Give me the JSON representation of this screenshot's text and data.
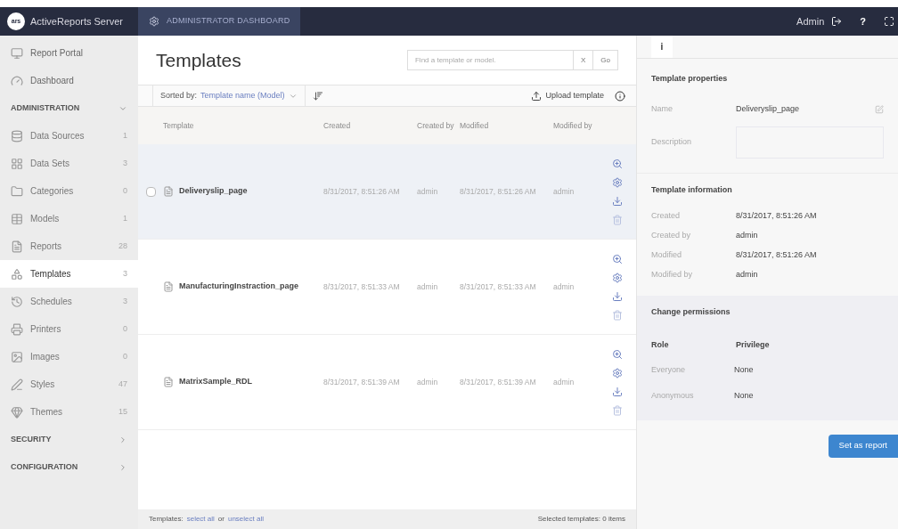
{
  "topbar": {
    "brand": "ActiveReports Server",
    "logo": "ars",
    "tab": "ADMINISTRATOR DASHBOARD",
    "user": "Admin",
    "help": "?"
  },
  "sidebar": {
    "links": [
      {
        "label": "Report Portal"
      },
      {
        "label": "Dashboard"
      }
    ],
    "sections": [
      {
        "title": "ADMINISTRATION",
        "expanded": true,
        "items": [
          {
            "label": "Data Sources",
            "count": "1",
            "selected": false
          },
          {
            "label": "Data Sets",
            "count": "3",
            "selected": false
          },
          {
            "label": "Categories",
            "count": "0",
            "selected": false
          },
          {
            "label": "Models",
            "count": "1",
            "selected": false
          },
          {
            "label": "Reports",
            "count": "28",
            "selected": false
          },
          {
            "label": "Templates",
            "count": "3",
            "selected": true
          },
          {
            "label": "Schedules",
            "count": "3",
            "selected": false
          },
          {
            "label": "Printers",
            "count": "0",
            "selected": false
          },
          {
            "label": "Images",
            "count": "0",
            "selected": false
          },
          {
            "label": "Styles",
            "count": "47",
            "selected": false
          },
          {
            "label": "Themes",
            "count": "15",
            "selected": false
          }
        ]
      },
      {
        "title": "SECURITY",
        "expanded": false
      },
      {
        "title": "CONFIGURATION",
        "expanded": false
      }
    ]
  },
  "main": {
    "title": "Templates",
    "search": {
      "placeholder": "Find a template or model.",
      "clear": "X",
      "go": "Go"
    },
    "sort": {
      "label": "Sorted by:",
      "value": "Template name (Model)"
    },
    "upload": "Upload template",
    "columns": [
      "Template",
      "Created",
      "Created by",
      "Modified",
      "Modified by"
    ],
    "rows": [
      {
        "name": "Deliveryslip_page",
        "created": "8/31/2017, 8:51:26 AM",
        "created_by": "admin",
        "modified": "8/31/2017, 8:51:26 AM",
        "modified_by": "admin",
        "selected": true
      },
      {
        "name": "ManufacturingInstraction_page",
        "created": "8/31/2017, 8:51:33 AM",
        "created_by": "admin",
        "modified": "8/31/2017, 8:51:33 AM",
        "modified_by": "admin",
        "selected": false
      },
      {
        "name": "MatrixSample_RDL",
        "created": "8/31/2017, 8:51:39 AM",
        "created_by": "admin",
        "modified": "8/31/2017, 8:51:39 AM",
        "modified_by": "admin",
        "selected": false
      }
    ],
    "footer": {
      "prefix": "Templates:",
      "select_all": "select all",
      "or": "or",
      "unselect_all": "unselect all",
      "selected": "Selected templates: 0 items"
    }
  },
  "panel": {
    "tab": "i",
    "properties": {
      "title": "Template properties",
      "fields": [
        {
          "label": "Name",
          "value": "Deliveryslip_page"
        },
        {
          "label": "Description"
        }
      ]
    },
    "information": {
      "title": "Template information",
      "rows": [
        {
          "label": "Created",
          "value": "8/31/2017, 8:51:26 AM"
        },
        {
          "label": "Created by",
          "value": "admin"
        },
        {
          "label": "Modified",
          "value": "8/31/2017, 8:51:26 AM"
        },
        {
          "label": "Modified by",
          "value": "admin"
        }
      ]
    },
    "permissions": {
      "title": "Change permissions",
      "columns": [
        "Role",
        "Privilege"
      ],
      "rows": [
        {
          "role": "Everyone",
          "privilege": "None"
        },
        {
          "role": "Anonymous",
          "privilege": "None"
        }
      ]
    },
    "button": "Set as report"
  }
}
